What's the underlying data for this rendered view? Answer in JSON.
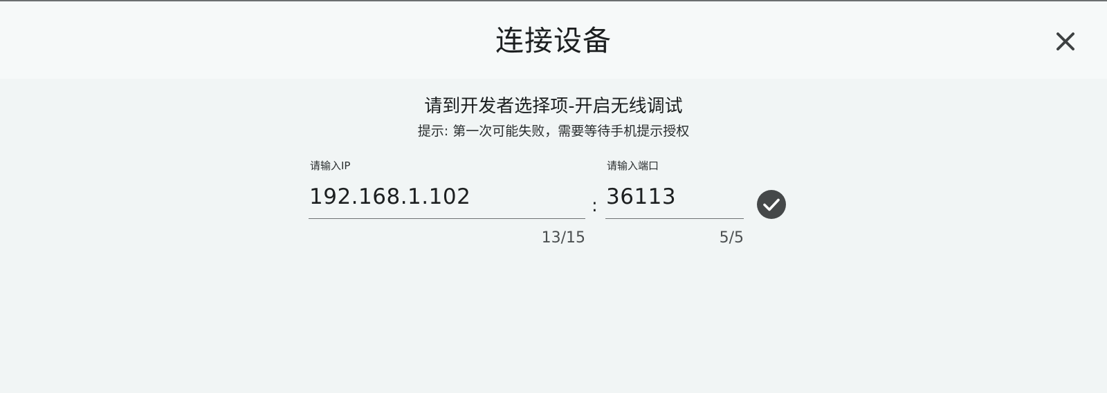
{
  "dialog": {
    "title": "连接设备",
    "instruction": "请到开发者选择项-开启无线调试",
    "hint": "提示: 第一次可能失败，需要等待手机提示授权"
  },
  "ip_field": {
    "label": "请输入IP",
    "value": "192.168.1.102",
    "counter": "13/15"
  },
  "port_field": {
    "label": "请输入端口",
    "value": "36113",
    "counter": "5/5"
  },
  "separator": ":",
  "icons": {
    "close": "close-icon",
    "confirm": "check-circle-icon"
  },
  "colors": {
    "background": "#f1f5f5",
    "header_background": "#f6f9f9",
    "confirm_button": "#454849",
    "text": "#1c1f20"
  }
}
